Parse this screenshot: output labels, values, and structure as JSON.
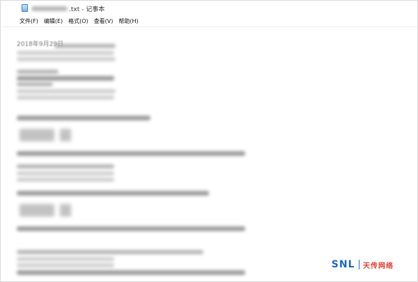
{
  "window": {
    "title_suffix": ".txt - 记事本"
  },
  "menu": {
    "file": "文件(F)",
    "edit": "编辑(E)",
    "format": "格式(O)",
    "view": "查看(V)",
    "help": "帮助(H)"
  },
  "document": {
    "date_line": "2018年9月29日"
  },
  "watermark": {
    "logo": "SNL",
    "name": "天传网络"
  }
}
